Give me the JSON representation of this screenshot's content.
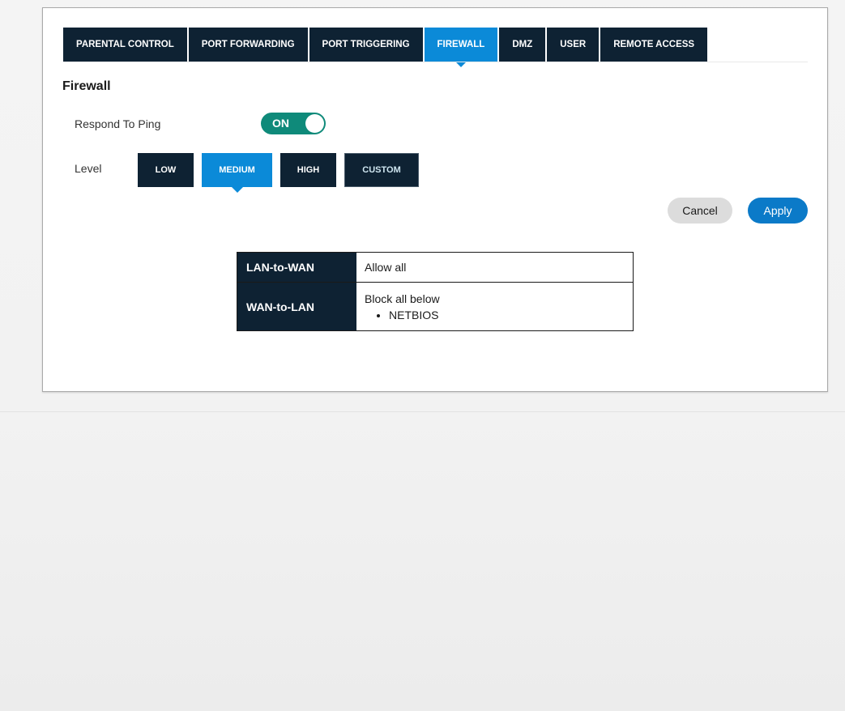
{
  "tabs": [
    {
      "label": "PARENTAL CONTROL",
      "active": false
    },
    {
      "label": "PORT FORWARDING",
      "active": false
    },
    {
      "label": "PORT TRIGGERING",
      "active": false
    },
    {
      "label": "FIREWALL",
      "active": true
    },
    {
      "label": "DMZ",
      "active": false
    },
    {
      "label": "USER",
      "active": false
    },
    {
      "label": "REMOTE ACCESS",
      "active": false
    }
  ],
  "section_title": "Firewall",
  "ping": {
    "label": "Respond To Ping",
    "toggle_text": "ON",
    "enabled": true
  },
  "level": {
    "label": "Level",
    "options": [
      "LOW",
      "MEDIUM",
      "HIGH",
      "CUSTOM"
    ],
    "selected": "MEDIUM"
  },
  "actions": {
    "cancel": "Cancel",
    "apply": "Apply"
  },
  "rules": [
    {
      "direction": "LAN-to-WAN",
      "policy": "Allow all",
      "items": []
    },
    {
      "direction": "WAN-to-LAN",
      "policy": "Block all below",
      "items": [
        "NETBIOS"
      ]
    }
  ],
  "colors": {
    "tab_bg": "#0e2233",
    "accent": "#0b8ad8",
    "toggle_on": "#0f8a7a",
    "apply_bg": "#0b7ac8",
    "cancel_bg": "#dcdcdc"
  }
}
